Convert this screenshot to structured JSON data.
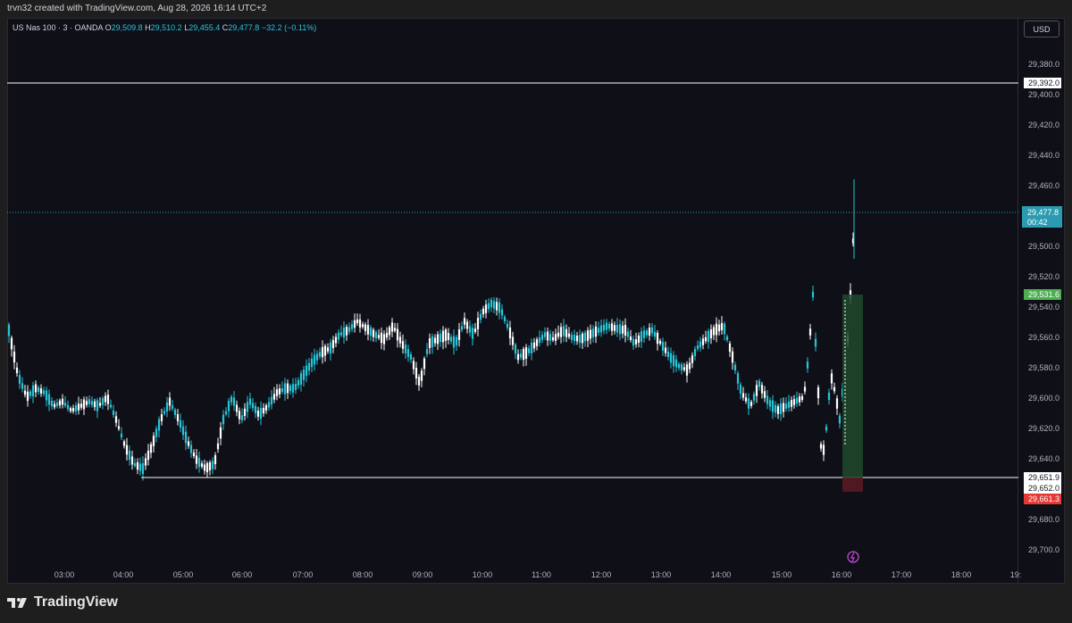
{
  "caption": "trvn32 created with TradingView.com, Aug 28, 2026 16:14 UTC+2",
  "legend": {
    "symbol": "US Nas 100 · 3 · OANDA",
    "o_label": "O",
    "o_value": "29,509.8",
    "h_label": "H",
    "h_value": "29,510.2",
    "l_label": "L",
    "l_value": "29,455.4",
    "c_label": "C",
    "c_value": "29,477.8",
    "change": "−32.2 (−0.11%)"
  },
  "currency_button": "USD",
  "price_axis": {
    "ticks": [
      "29,380.0",
      "29,400.0",
      "29,420.0",
      "29,440.0",
      "29,460.0",
      "29,500.0",
      "29,520.0",
      "29,540.0",
      "29,560.0",
      "29,580.0",
      "29,600.0",
      "29,620.0",
      "29,640.0",
      "29,680.0",
      "29,700.0"
    ],
    "labels": {
      "line_top": "29,392.0",
      "current_price": "29,477.8",
      "countdown": "00:42",
      "take_profit": "29,531.6",
      "entry": "29,651.9",
      "line_bottom": "29,652.0",
      "stop_loss": "29,661.3"
    }
  },
  "time_axis": {
    "ticks": [
      "03:00",
      "04:00",
      "05:00",
      "06:00",
      "07:00",
      "08:00",
      "09:00",
      "10:00",
      "11:00",
      "12:00",
      "13:00",
      "14:00",
      "15:00",
      "16:00",
      "17:00",
      "18:00",
      "19:"
    ]
  },
  "brand": "TradingView",
  "colors": {
    "background": "#0e0f17",
    "candle_up": "#26c6da",
    "candle_down": "#ffffff",
    "current_price": "#2a9bb0",
    "take_profit": "#4caf50",
    "stop_loss": "#e53935",
    "grid_text": "#b2b5be"
  }
}
